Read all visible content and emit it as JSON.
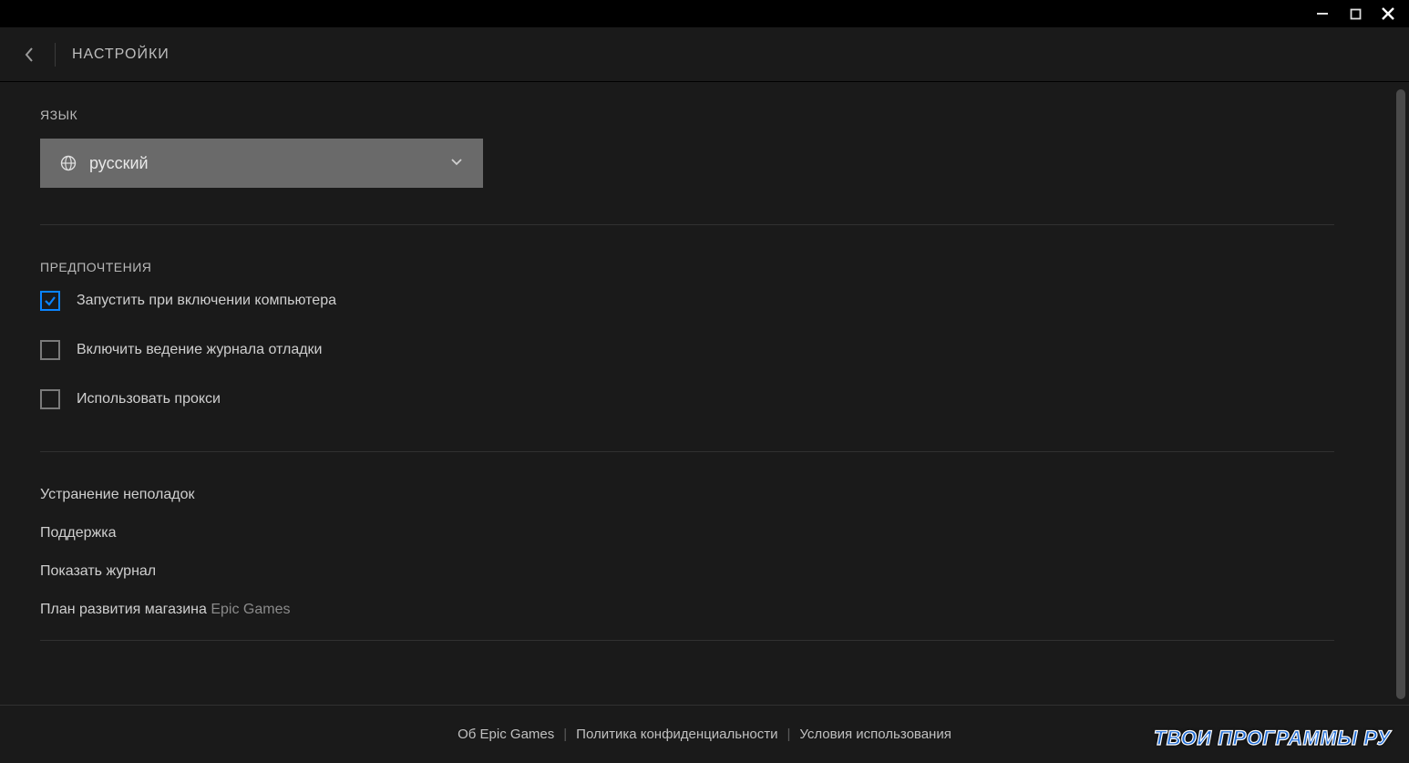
{
  "window": {
    "minimize_icon": "minimize",
    "maximize_icon": "maximize",
    "close_icon": "close"
  },
  "header": {
    "title": "НАСТРОЙКИ"
  },
  "language": {
    "section_label": "ЯЗЫК",
    "selected": "русский"
  },
  "preferences": {
    "section_label": "ПРЕДПОЧТЕНИЯ",
    "items": [
      {
        "label": "Запустить при включении компьютера",
        "checked": true
      },
      {
        "label": "Включить ведение журнала отладки",
        "checked": false
      },
      {
        "label": "Использовать прокси",
        "checked": false
      }
    ]
  },
  "links": {
    "items": [
      {
        "label": "Устранение неполадок",
        "muted": ""
      },
      {
        "label": "Поддержка",
        "muted": ""
      },
      {
        "label": "Показать журнал",
        "muted": ""
      },
      {
        "label": "План развития магазина ",
        "muted": "Epic Games"
      }
    ]
  },
  "footer": {
    "about": "Об Epic Games",
    "privacy": "Политика конфиденциальности",
    "terms": "Условия использования"
  },
  "watermark": "ТВОИ ПРОГРАММЫ РУ"
}
